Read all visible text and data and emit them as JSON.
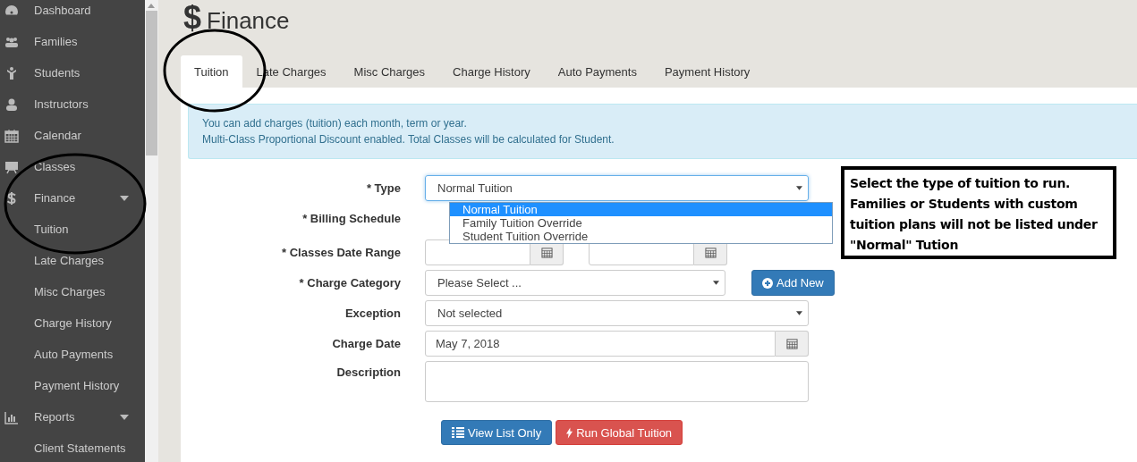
{
  "sidebar": {
    "items": [
      {
        "label": "Dashboard"
      },
      {
        "label": "Families"
      },
      {
        "label": "Students"
      },
      {
        "label": "Instructors"
      },
      {
        "label": "Calendar"
      },
      {
        "label": "Classes"
      },
      {
        "label": "Finance",
        "expanded": true,
        "children": [
          {
            "label": "Tuition"
          },
          {
            "label": "Late Charges"
          },
          {
            "label": "Misc Charges"
          },
          {
            "label": "Charge History"
          },
          {
            "label": "Auto Payments"
          },
          {
            "label": "Payment History"
          }
        ]
      },
      {
        "label": "Reports",
        "expanded": true,
        "children": [
          {
            "label": "Client Statements"
          }
        ]
      }
    ]
  },
  "page": {
    "icon": "$",
    "title": "Finance"
  },
  "tabs": [
    {
      "label": "Tuition",
      "selected": true
    },
    {
      "label": "Late Charges",
      "selected": false
    },
    {
      "label": "Misc Charges",
      "selected": false
    },
    {
      "label": "Charge History",
      "selected": false
    },
    {
      "label": "Auto Payments",
      "selected": false
    },
    {
      "label": "Payment History",
      "selected": false
    }
  ],
  "alert": [
    "You can add charges (tuition) each month, term or year.",
    "Multi-Class Proportional Discount enabled. Total Classes will be calculated for Student."
  ],
  "form": {
    "fields": [
      {
        "kind": "select",
        "label": "* Type",
        "value": "Normal Tuition",
        "open": true,
        "options": [
          {
            "label": "Normal Tuition",
            "selected": true
          },
          {
            "label": "Family Tuition Override",
            "selected": false
          },
          {
            "label": "Student Tuition Override",
            "selected": false
          }
        ]
      },
      {
        "kind": "hidden",
        "label": "* Billing Schedule"
      },
      {
        "kind": "daterange",
        "label": "* Classes Date Range"
      },
      {
        "kind": "select-add",
        "label": "* Charge Category",
        "value": "Please Select ...",
        "button": "Add New"
      },
      {
        "kind": "select",
        "label": "Exception",
        "value": "Not selected"
      },
      {
        "kind": "date",
        "label": "Charge Date",
        "value": "May 7, 2018"
      },
      {
        "kind": "textarea",
        "label": "Description"
      }
    ],
    "buttons": [
      {
        "kind": "primary",
        "label": "View List Only"
      },
      {
        "kind": "danger",
        "label": "Run Global Tuition"
      }
    ]
  },
  "callout": "Select the type of tuition to run. Families or Students with custom tuition plans will not be listed under \"Normal\" Tution"
}
